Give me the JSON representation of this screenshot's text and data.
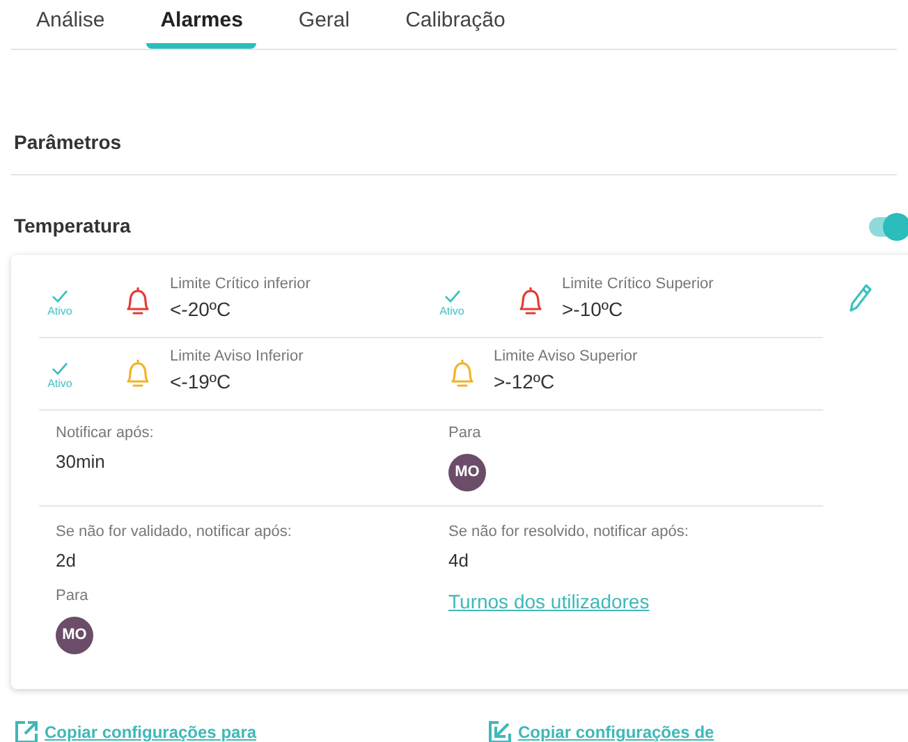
{
  "tabs": [
    {
      "label": "Análise",
      "selected": false
    },
    {
      "label": "Alarmes",
      "selected": true
    },
    {
      "label": "Geral",
      "selected": false
    },
    {
      "label": "Calibração",
      "selected": false
    }
  ],
  "section_title": "Parâmetros",
  "sensor": {
    "name": "Temperatura",
    "enabled": true
  },
  "alarm_rows": [
    [
      {
        "kind": "critical",
        "active": true,
        "status": "Ativo",
        "label": "Limite Crítico inferior",
        "value": "<-20ºC"
      },
      {
        "kind": "critical",
        "active": true,
        "status": "Ativo",
        "label": "Limite Crítico Superior",
        "value": ">-10ºC"
      }
    ],
    [
      {
        "kind": "warning",
        "active": true,
        "status": "Ativo",
        "label": "Limite Aviso Inferior",
        "value": "<-19ºC"
      },
      {
        "kind": "warning",
        "active": false,
        "label": "Limite Aviso Superior",
        "value": ">-12ºC"
      }
    ]
  ],
  "notify": {
    "label": "Notificar após:",
    "value": "30min",
    "recipients_label": "Para",
    "recipients": [
      "MO"
    ]
  },
  "not_validated": {
    "label": "Se não for validado, notificar após:",
    "value": "2d",
    "recipients_label": "Para",
    "recipients": [
      "MO"
    ]
  },
  "not_resolved": {
    "label": "Se não for resolvido, notificar após:",
    "value": "4d",
    "link": "Turnos dos utilizadores"
  },
  "links": [
    {
      "kind": "export",
      "label": "Copiar configurações para"
    },
    {
      "kind": "import",
      "label": "Copiar configurações de"
    }
  ]
}
